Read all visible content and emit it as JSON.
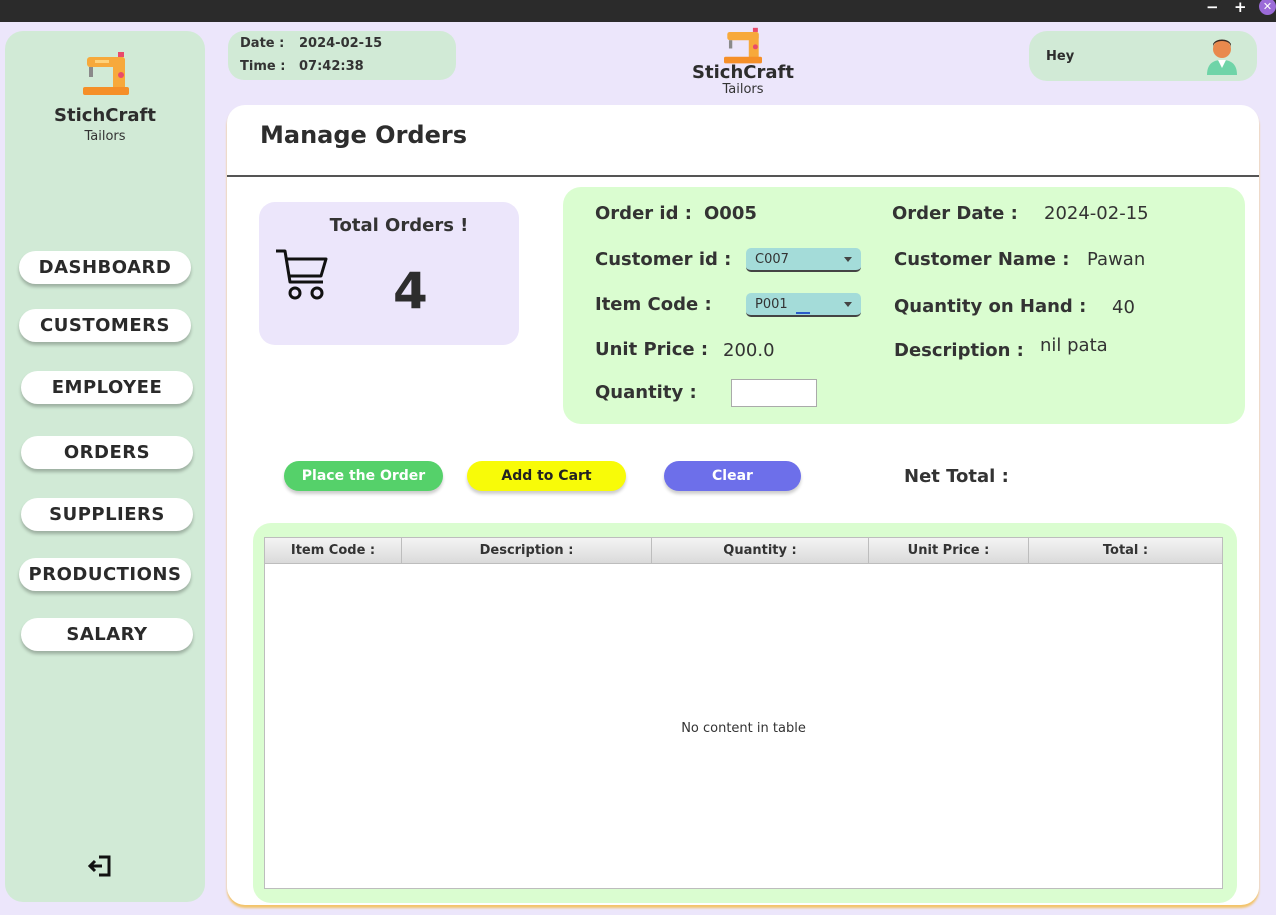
{
  "window": {
    "minimize": "−",
    "maximize": "+",
    "close": "✕"
  },
  "brand": {
    "name": "StichCraft",
    "subtitle": "Tailors",
    "logo_icon": "sewing-machine-icon"
  },
  "sidebar": {
    "items": [
      {
        "label": "DASHBOARD"
      },
      {
        "label": "CUSTOMERS"
      },
      {
        "label": "EMPLOYEE"
      },
      {
        "label": "ORDERS"
      },
      {
        "label": "SUPPLIERS"
      },
      {
        "label": "PRODUCTIONS"
      },
      {
        "label": "SALARY"
      }
    ],
    "logout_icon": "logout-icon"
  },
  "header": {
    "date_label": "Date :",
    "date_value": "2024-02-15",
    "time_label": "Time :",
    "time_value": "07:42:38",
    "greeting": "Hey",
    "avatar_icon": "user-avatar-icon"
  },
  "page": {
    "title": "Manage Orders"
  },
  "stats": {
    "title": "Total Orders !",
    "value": "4",
    "icon": "shopping-cart-icon"
  },
  "form": {
    "order_id_label": "Order id :",
    "order_id_value": "O005",
    "order_date_label": "Order Date :",
    "order_date_value": "2024-02-15",
    "customer_id_label": "Customer id :",
    "customer_id_value": "C007",
    "customer_name_label": "Customer Name :",
    "customer_name_value": "Pawan",
    "item_code_label": "Item Code :",
    "item_code_value": "P001",
    "qoh_label": "Quantity on Hand :",
    "qoh_value": "40",
    "unit_price_label": "Unit Price :",
    "unit_price_value": "200.0",
    "description_label": "Description :",
    "description_value": "nil pata",
    "quantity_label": "Quantity :",
    "quantity_value": ""
  },
  "actions": {
    "place_order": "Place the Order",
    "add_to_cart": "Add to Cart",
    "clear": "Clear",
    "net_total_label": "Net Total :",
    "colors": {
      "place_order": "#55d16a",
      "add_to_cart": "#f8fb08",
      "clear": "#6d6fea"
    }
  },
  "table": {
    "columns": [
      "Item Code :",
      "Description :",
      "Quantity :",
      "Unit Price :",
      "Total :"
    ],
    "rows": [],
    "empty_message": "No content in table"
  }
}
